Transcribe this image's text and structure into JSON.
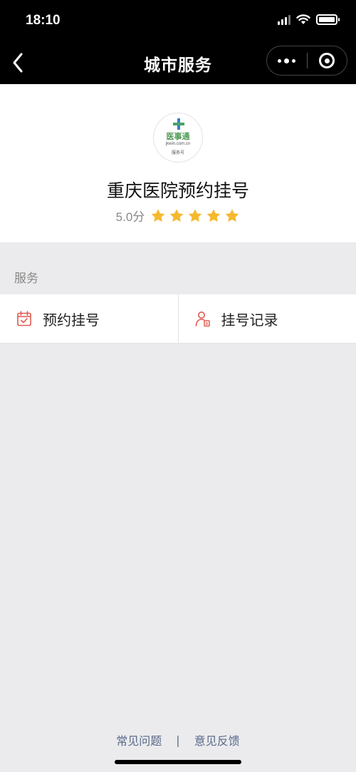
{
  "status_bar": {
    "time": "18:10"
  },
  "nav": {
    "title": "城市服务"
  },
  "profile": {
    "logo_text": "医事通",
    "logo_url": "jkwin.com.cn",
    "logo_sub": "服务号",
    "name": "重庆医院预约挂号",
    "score": "5.0分",
    "stars": 5
  },
  "services": {
    "section_label": "服务",
    "items": [
      {
        "label": "预约挂号",
        "icon": "calendar-check-icon"
      },
      {
        "label": "挂号记录",
        "icon": "user-record-icon"
      }
    ]
  },
  "footer": {
    "faq": "常见问题",
    "divider": "|",
    "feedback": "意见反馈"
  },
  "colors": {
    "topbar": "#000000",
    "star": "#f5b92e",
    "service_icon": "#e05a4f",
    "footer_link": "#5a6a8a"
  }
}
